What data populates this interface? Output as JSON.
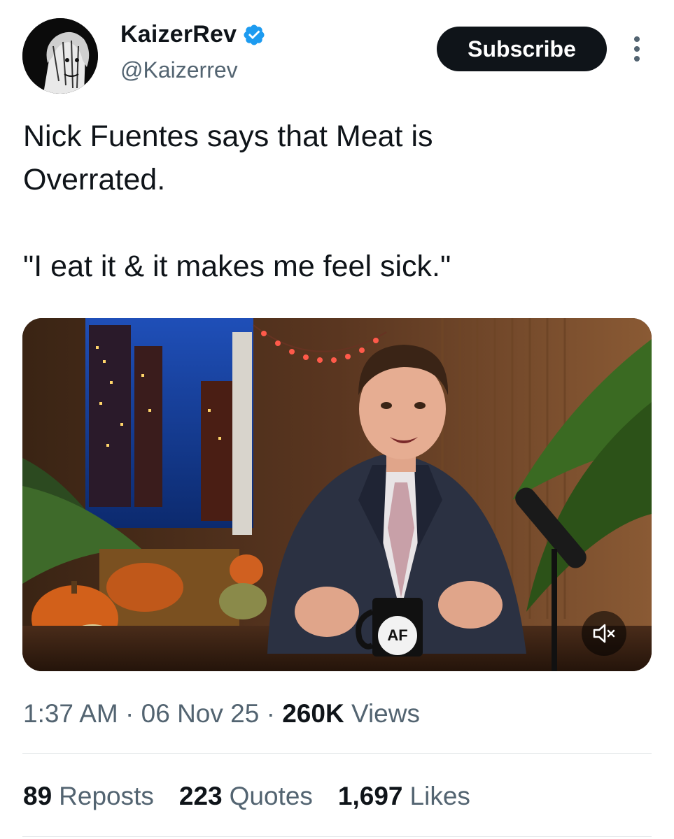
{
  "author": {
    "display_name": "KaizerRev",
    "handle": "@Kaizerrev",
    "verified": true,
    "avatar_icon": "anime-portrait-avatar"
  },
  "header": {
    "subscribe_label": "Subscribe",
    "more_icon": "more-vertical-icon"
  },
  "tweet": {
    "line1": "Nick Fuentes says that Meat is Overrated.",
    "line2": "\"I eat it & it makes me feel sick.\""
  },
  "media": {
    "mug_logo": "AF",
    "mute_icon": "volume-muted-icon"
  },
  "meta": {
    "time": "1:37 AM",
    "date": "06 Nov 25",
    "views_count": "260K",
    "views_label": "Views",
    "separator": "·"
  },
  "stats": {
    "reposts_count": "89",
    "reposts_label": "Reposts",
    "quotes_count": "223",
    "quotes_label": "Quotes",
    "likes_count": "1,697",
    "likes_label": "Likes"
  },
  "colors": {
    "text_primary": "#0f1419",
    "text_secondary": "#536471",
    "verified_blue": "#1d9bf0",
    "button_dark": "#0f1419"
  }
}
